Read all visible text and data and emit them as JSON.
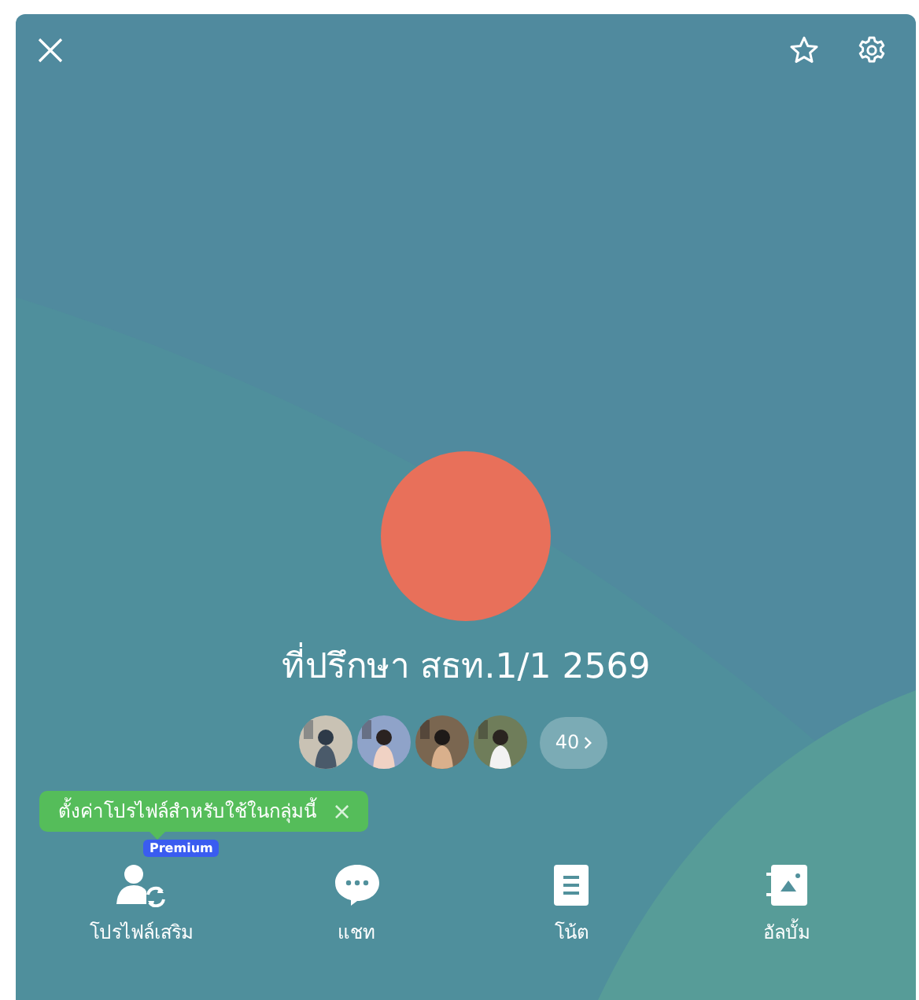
{
  "group": {
    "name": "ที่ปรึกษา สธท.1/1 2569"
  },
  "member_count": "40",
  "tooltip": {
    "text": "ตั้งค่าโปรไฟล์สำหรับใช้ในกลุ่มนี้",
    "close": "×"
  },
  "actions": [
    {
      "kind": "profile",
      "label": "โปรไฟล์เสริม",
      "badge": "Premium"
    },
    {
      "kind": "chat",
      "label": "แชท"
    },
    {
      "kind": "note",
      "label": "โน้ต"
    },
    {
      "kind": "album",
      "label": "อัลบั้ม"
    }
  ]
}
